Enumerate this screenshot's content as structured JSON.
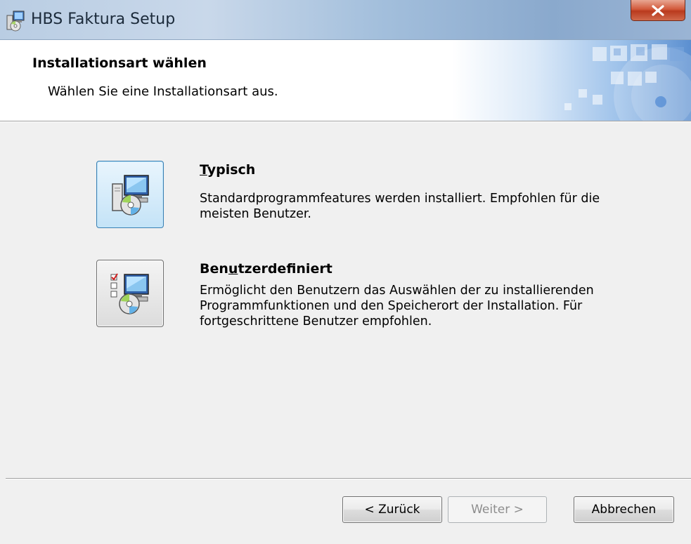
{
  "window": {
    "title": "HBS Faktura Setup",
    "close_glyph": "X"
  },
  "header": {
    "heading": "Installationsart wählen",
    "subheading": "Wählen Sie eine Installationsart aus."
  },
  "options": [
    {
      "title_underline": "T",
      "title_rest": "ypisch",
      "description": "Standardprogrammfeatures werden installiert. Empfohlen für die meisten Benutzer.",
      "icon": "computer-cd-icon",
      "focused": true
    },
    {
      "title_pre": "Ben",
      "title_underline": "u",
      "title_post": "tzerdefiniert",
      "description": "Ermöglicht den Benutzern das Auswählen der zu installierenden Programmfunktionen und den Speicherort der Installation. Für fortgeschrittene Benutzer empfohlen.",
      "icon": "checklist-computer-cd-icon",
      "focused": false
    }
  ],
  "buttons": {
    "back": "< Zurück",
    "next": "Weiter >",
    "cancel": "Abbrechen"
  },
  "colors": {
    "focus_border": "#3c7fb1",
    "close_red": "#c9462a"
  }
}
